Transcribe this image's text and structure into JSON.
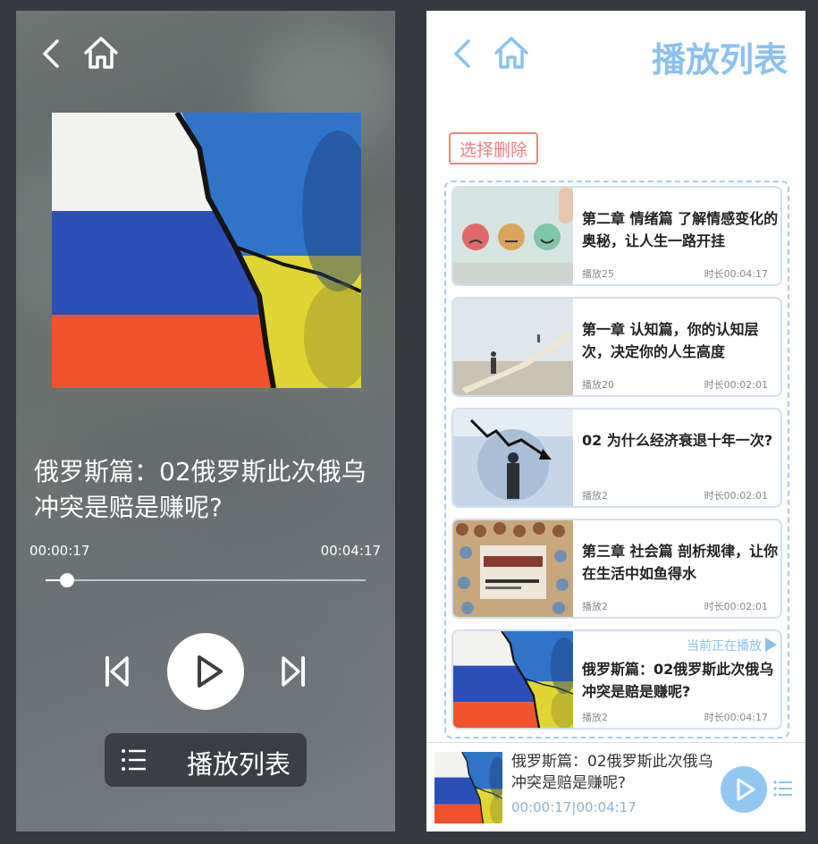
{
  "player": {
    "icons": {
      "back": "chevron-left-icon",
      "home": "home-icon",
      "prev": "skip-previous-icon",
      "play": "play-icon",
      "next": "skip-next-icon",
      "list": "list-icon"
    },
    "track_title": "俄罗斯篇：02俄罗斯此次俄乌冲突是赔是赚呢?",
    "current_time": "00:00:17",
    "duration": "00:04:17",
    "progress": 0.066,
    "playlist_button_label": "播放列表"
  },
  "playlist_page": {
    "title": "播放列表",
    "delete_button_label": "选择删除",
    "now_playing_label": "当前正在播放",
    "items": [
      {
        "title": "第二章 情绪篇 了解情感变化的奥秘，让人生一路开挂",
        "plays": "播放25",
        "duration": "时长00:04:17",
        "thumb": "emotion-faces"
      },
      {
        "title": "第一章 认知篇，你的认知层次，决定你的人生高度",
        "plays": "播放20",
        "duration": "时长00:02:01",
        "thumb": "stairs"
      },
      {
        "title": "02 为什么经济衰退十年一次?",
        "plays": "播放2",
        "duration": "时长00:02:01",
        "thumb": "falling-chart"
      },
      {
        "title": "第三章 社会篇 剖析规律，让你在生活中如鱼得水",
        "plays": "播放2",
        "duration": "时长00:02:01",
        "thumb": "social-psychology-book"
      },
      {
        "title": "俄罗斯篇：02俄罗斯此次俄乌冲突是赔是赚呢?",
        "plays": "播放2",
        "duration": "时长00:04:17",
        "thumb": "russia-ukraine-flags",
        "now_playing": true
      }
    ],
    "mini_player": {
      "title": "俄罗斯篇：02俄罗斯此次俄乌冲突是赔是赚呢?",
      "current_time": "00:00:17",
      "separator": "|",
      "duration": "00:04:17"
    }
  },
  "colors": {
    "accent": "#8cc1ee",
    "delete": "#f08080",
    "dashed_border": "#a9c8ec"
  }
}
